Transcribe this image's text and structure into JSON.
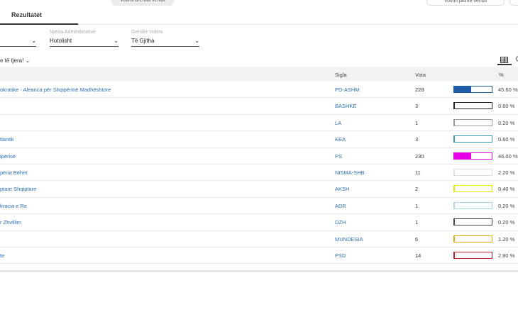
{
  "topbar": {
    "btn_inside": "Votimi brenda vendit",
    "btn_outside": "Votimi jashtë vendit",
    "btn_right": "Re"
  },
  "tabs": {
    "active": "Rezultatet"
  },
  "filters": [
    {
      "label": "",
      "value": ""
    },
    {
      "label": "Njësia Administrative",
      "value": "Hotolisht"
    },
    {
      "label": "Gender Votimi",
      "value": "Të Gjitha"
    }
  ],
  "more_link": "e të tjera! ⌄",
  "table": {
    "headers": {
      "name": "",
      "sigla": "Sigla",
      "vota": "Vota",
      "pct": "%"
    },
    "rows": [
      {
        "name": "okratike - Aleanca për Shqipërinë Madhështore",
        "sigla": "PD-ASHM",
        "vota": "228",
        "pct": "45.60 %",
        "share": 45.6,
        "color": "#1f5aa6"
      },
      {
        "name": "",
        "sigla": "BASHKE",
        "vota": "3",
        "pct": "0.60 %",
        "share": 0.6,
        "color": "#222222"
      },
      {
        "name": "",
        "sigla": "LA",
        "vota": "1",
        "pct": "0.20 %",
        "share": 0.2,
        "color": "#9a9a9a"
      },
      {
        "name": "tlantik",
        "sigla": "KEA",
        "vota": "3",
        "pct": "0.60 %",
        "share": 0.6,
        "color": "#3a9bb0"
      },
      {
        "name": "ipërisë",
        "sigla": "PS",
        "vota": "230",
        "pct": "46.00 %",
        "share": 46.0,
        "color": "#e600e6"
      },
      {
        "name": "përia Bëhet",
        "sigla": "NISMA-SHB",
        "vota": "11",
        "pct": "2.20 %",
        "share": 2.2,
        "color": "#e0e0e0"
      },
      {
        "name": "ptare Shqiptare",
        "sigla": "AKSH",
        "vota": "2",
        "pct": "0.40 %",
        "share": 0.4,
        "color": "#e8e800"
      },
      {
        "name": "kracia e Re",
        "sigla": "ADR",
        "vota": "1",
        "pct": "0.20 %",
        "share": 0.2,
        "color": "#a8d8e8"
      },
      {
        "name": "r Zhvillim",
        "sigla": "DZH",
        "vota": "1",
        "pct": "0.20 %",
        "share": 0.2,
        "color": "#444444"
      },
      {
        "name": "",
        "sigla": "MUNDESIA",
        "vota": "6",
        "pct": "1.20 %",
        "share": 1.2,
        "color": "#e0b000"
      },
      {
        "name": "te",
        "sigla": "PSD",
        "vota": "14",
        "pct": "2.80 %",
        "share": 2.8,
        "color": "#c0202a"
      }
    ]
  }
}
